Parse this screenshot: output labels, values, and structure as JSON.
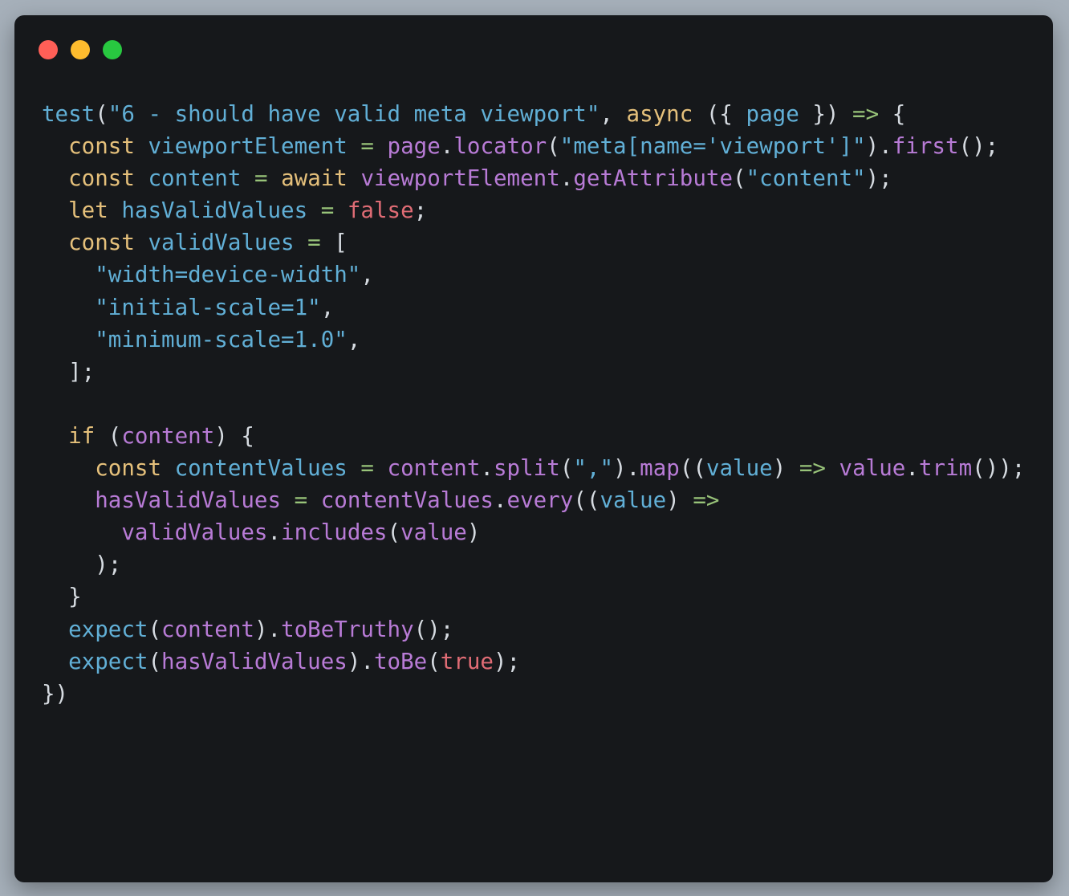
{
  "window": {
    "controls": {
      "close_color": "#ff5f57",
      "minimize_color": "#febc2e",
      "maximize_color": "#28c840"
    }
  },
  "editor": {
    "language": "javascript",
    "lines": [
      [
        [
          "fn",
          "test"
        ],
        [
          "pl",
          "("
        ],
        [
          "str",
          "\"6 - should have valid meta viewport\""
        ],
        [
          "pl",
          ", "
        ],
        [
          "kw",
          "async"
        ],
        [
          "pl",
          " ({ "
        ],
        [
          "vr",
          "page"
        ],
        [
          "pl",
          " }) "
        ],
        [
          "op",
          "=>"
        ],
        [
          "pl",
          " {"
        ]
      ],
      [
        [
          "pl",
          "  "
        ],
        [
          "kw",
          "const"
        ],
        [
          "pl",
          " "
        ],
        [
          "vr",
          "viewportElement"
        ],
        [
          "pl",
          " "
        ],
        [
          "op",
          "="
        ],
        [
          "pl",
          " "
        ],
        [
          "mt",
          "page"
        ],
        [
          "pl",
          "."
        ],
        [
          "mt",
          "locator"
        ],
        [
          "pl",
          "("
        ],
        [
          "str",
          "\"meta[name='viewport']\""
        ],
        [
          "pl",
          ")."
        ],
        [
          "mt",
          "first"
        ],
        [
          "pl",
          "();"
        ]
      ],
      [
        [
          "pl",
          "  "
        ],
        [
          "kw",
          "const"
        ],
        [
          "pl",
          " "
        ],
        [
          "vr",
          "content"
        ],
        [
          "pl",
          " "
        ],
        [
          "op",
          "="
        ],
        [
          "pl",
          " "
        ],
        [
          "kw",
          "await"
        ],
        [
          "pl",
          " "
        ],
        [
          "mt",
          "viewportElement"
        ],
        [
          "pl",
          "."
        ],
        [
          "mt",
          "getAttribute"
        ],
        [
          "pl",
          "("
        ],
        [
          "str",
          "\"content\""
        ],
        [
          "pl",
          ");"
        ]
      ],
      [
        [
          "pl",
          "  "
        ],
        [
          "kw",
          "let"
        ],
        [
          "pl",
          " "
        ],
        [
          "vr",
          "hasValidValues"
        ],
        [
          "pl",
          " "
        ],
        [
          "op",
          "="
        ],
        [
          "pl",
          " "
        ],
        [
          "lit",
          "false"
        ],
        [
          "pl",
          ";"
        ]
      ],
      [
        [
          "pl",
          "  "
        ],
        [
          "kw",
          "const"
        ],
        [
          "pl",
          " "
        ],
        [
          "vr",
          "validValues"
        ],
        [
          "pl",
          " "
        ],
        [
          "op",
          "="
        ],
        [
          "pl",
          " ["
        ]
      ],
      [
        [
          "pl",
          "    "
        ],
        [
          "str",
          "\"width=device-width\""
        ],
        [
          "pl",
          ","
        ]
      ],
      [
        [
          "pl",
          "    "
        ],
        [
          "str",
          "\"initial-scale=1\""
        ],
        [
          "pl",
          ","
        ]
      ],
      [
        [
          "pl",
          "    "
        ],
        [
          "str",
          "\"minimum-scale=1.0\""
        ],
        [
          "pl",
          ","
        ]
      ],
      [
        [
          "pl",
          "  ];"
        ]
      ],
      [],
      [
        [
          "pl",
          "  "
        ],
        [
          "kw",
          "if"
        ],
        [
          "pl",
          " ("
        ],
        [
          "mt",
          "content"
        ],
        [
          "pl",
          ") {"
        ]
      ],
      [
        [
          "pl",
          "    "
        ],
        [
          "kw",
          "const"
        ],
        [
          "pl",
          " "
        ],
        [
          "vr",
          "contentValues"
        ],
        [
          "pl",
          " "
        ],
        [
          "op",
          "="
        ],
        [
          "pl",
          " "
        ],
        [
          "mt",
          "content"
        ],
        [
          "pl",
          "."
        ],
        [
          "mt",
          "split"
        ],
        [
          "pl",
          "("
        ],
        [
          "str",
          "\",\""
        ],
        [
          "pl",
          ")."
        ],
        [
          "mt",
          "map"
        ],
        [
          "pl",
          "(("
        ],
        [
          "vr",
          "value"
        ],
        [
          "pl",
          ") "
        ],
        [
          "op",
          "=>"
        ],
        [
          "pl",
          " "
        ],
        [
          "mt",
          "value"
        ],
        [
          "pl",
          "."
        ],
        [
          "mt",
          "trim"
        ],
        [
          "pl",
          "());"
        ]
      ],
      [
        [
          "pl",
          "    "
        ],
        [
          "mt",
          "hasValidValues"
        ],
        [
          "pl",
          " "
        ],
        [
          "op",
          "="
        ],
        [
          "pl",
          " "
        ],
        [
          "mt",
          "contentValues"
        ],
        [
          "pl",
          "."
        ],
        [
          "mt",
          "every"
        ],
        [
          "pl",
          "(("
        ],
        [
          "vr",
          "value"
        ],
        [
          "pl",
          ") "
        ],
        [
          "op",
          "=>"
        ]
      ],
      [
        [
          "pl",
          "      "
        ],
        [
          "mt",
          "validValues"
        ],
        [
          "pl",
          "."
        ],
        [
          "mt",
          "includes"
        ],
        [
          "pl",
          "("
        ],
        [
          "mt",
          "value"
        ],
        [
          "pl",
          ")"
        ]
      ],
      [
        [
          "pl",
          "    );"
        ]
      ],
      [
        [
          "pl",
          "  }"
        ]
      ],
      [
        [
          "pl",
          "  "
        ],
        [
          "fn",
          "expect"
        ],
        [
          "pl",
          "("
        ],
        [
          "mt",
          "content"
        ],
        [
          "pl",
          ")."
        ],
        [
          "mt",
          "toBeTruthy"
        ],
        [
          "pl",
          "();"
        ]
      ],
      [
        [
          "pl",
          "  "
        ],
        [
          "fn",
          "expect"
        ],
        [
          "pl",
          "("
        ],
        [
          "mt",
          "hasValidValues"
        ],
        [
          "pl",
          ")."
        ],
        [
          "mt",
          "toBe"
        ],
        [
          "pl",
          "("
        ],
        [
          "lit",
          "true"
        ],
        [
          "pl",
          ");"
        ]
      ],
      [
        [
          "pl",
          "})"
        ]
      ]
    ]
  }
}
